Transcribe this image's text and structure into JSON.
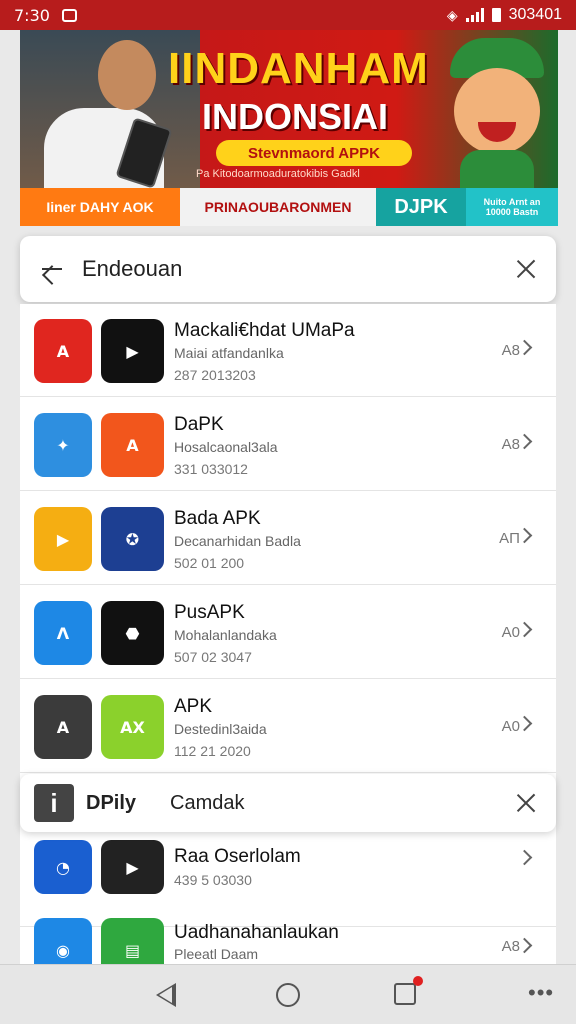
{
  "status_bar": {
    "time": "7:30",
    "right_text": "303401"
  },
  "banner": {
    "title_line1": "IINDANHAM",
    "title_line2": "INDONSIAI",
    "pill_text": "Stevnmaord APPK",
    "sub_text": "Pa Kitodoarmoaduratokibis Gadkl",
    "strip": [
      "Iiner DAHY AOK",
      "PRINAOUBARONMEN",
      "DJPK",
      "Nuito Arnt an 10000 Bastn"
    ]
  },
  "search": {
    "query": "Endeouan"
  },
  "apps": [
    {
      "name": "Mackali€hdat UMaPa",
      "subtitle": "Maiai atfandanlka",
      "date": "287 2013203",
      "tag": "A8",
      "icon1": {
        "glyph": "A",
        "bg": "#e0261f"
      },
      "icon2": {
        "glyph": "▶",
        "bg": "#111111"
      }
    },
    {
      "name": "DaPK",
      "subtitle": "Hosalcaonal3ala",
      "date": "331 033012",
      "tag": "A8",
      "icon1": {
        "glyph": "✦",
        "bg": "#2e8fe0"
      },
      "icon2": {
        "glyph": "A",
        "bg": "#f2561c"
      }
    },
    {
      "name": "Bada APK",
      "subtitle": "Decanarhidan Badla",
      "date": "502 01 200",
      "tag": "AΠ",
      "icon1": {
        "glyph": "▶",
        "bg": "#f5ae12"
      },
      "icon2": {
        "glyph": "✪",
        "bg": "#1d3f92"
      }
    },
    {
      "name": "PusAPK",
      "subtitle": "Mohalanlandaka",
      "date": "507 02 3047",
      "tag": "A0",
      "icon1": {
        "glyph": "Λ",
        "bg": "#1e88e5"
      },
      "icon2": {
        "glyph": "⬣",
        "bg": "#111111"
      }
    },
    {
      "name": "APK",
      "subtitle": "Destedinl3aida",
      "date": "112 21 2020",
      "tag": "A0",
      "icon1": {
        "glyph": "A",
        "bg": "#3b3b3b"
      },
      "icon2": {
        "glyph": "AX",
        "bg": "#8bd12c"
      }
    },
    {
      "name": "Raa Oserlolam",
      "subtitle": "",
      "date": "439 5 03030",
      "tag": "",
      "icon1": {
        "glyph": "◔",
        "bg": "#1a5fd0"
      },
      "icon2": {
        "glyph": "▶",
        "bg": "#222222"
      }
    },
    {
      "name": "Uadhanahanlaukan",
      "subtitle": "Pleeatl Daam",
      "date": "",
      "tag": "A8",
      "icon1": {
        "glyph": "◉",
        "bg": "#1e88e5"
      },
      "icon2": {
        "glyph": "▤",
        "bg": "#2fa83f"
      }
    }
  ],
  "overlay": {
    "label": "DPily",
    "text": "Camdak"
  },
  "colors": {
    "status_bar": "#b71c1c",
    "accent": "#ffd21a"
  }
}
